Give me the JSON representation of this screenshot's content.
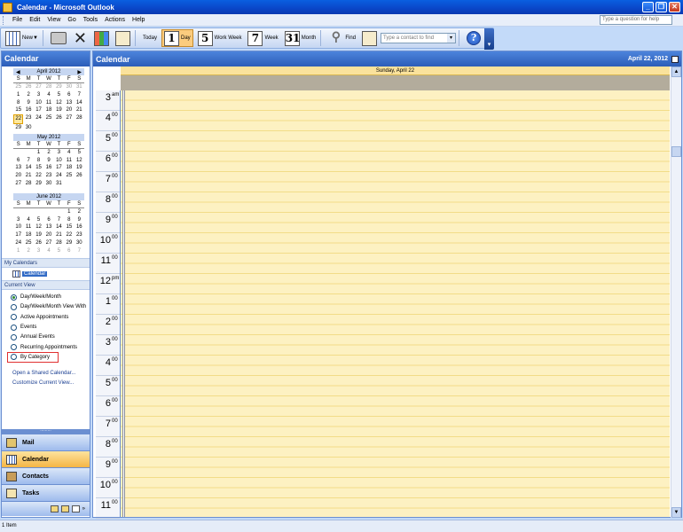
{
  "window": {
    "title": "Calendar - Microsoft Outlook",
    "buttons": [
      "_",
      "❐",
      "✕"
    ]
  },
  "menu": {
    "items": [
      "File",
      "Edit",
      "View",
      "Go",
      "Tools",
      "Actions",
      "Help"
    ],
    "help_placeholder": "Type a question for help"
  },
  "toolbar": {
    "new_label": "New",
    "today_label": "Today",
    "day_num": "1",
    "day_label": "Day",
    "workweek_num": "5",
    "workweek_label": "Work Week",
    "week_num": "7",
    "week_label": "Week",
    "month_num": "31",
    "month_label": "Month",
    "find_label": "Find",
    "contact_placeholder": "Type a contact to find",
    "help_glyph": "?"
  },
  "nav": {
    "title": "Calendar",
    "months": [
      {
        "title": "April 2012",
        "days": [
          "S",
          "M",
          "T",
          "W",
          "T",
          "F",
          "S"
        ],
        "dates": [
          "25",
          "26",
          "27",
          "28",
          "29",
          "30",
          "31",
          "1",
          "2",
          "3",
          "4",
          "5",
          "6",
          "7",
          "8",
          "9",
          "10",
          "11",
          "12",
          "13",
          "14",
          "15",
          "16",
          "17",
          "18",
          "19",
          "20",
          "21",
          "22",
          "23",
          "24",
          "25",
          "26",
          "27",
          "28",
          "29",
          "30"
        ],
        "dim": [
          0,
          1,
          2,
          3,
          4,
          5,
          6
        ],
        "selected": 28
      },
      {
        "title": "May 2012",
        "days": [
          "S",
          "M",
          "T",
          "W",
          "T",
          "F",
          "S"
        ],
        "dates": [
          "",
          "",
          "1",
          "2",
          "3",
          "4",
          "5",
          "6",
          "7",
          "8",
          "9",
          "10",
          "11",
          "12",
          "13",
          "14",
          "15",
          "16",
          "17",
          "18",
          "19",
          "20",
          "21",
          "22",
          "23",
          "24",
          "25",
          "26",
          "27",
          "28",
          "29",
          "30",
          "31"
        ],
        "dim": [],
        "selected": -1
      },
      {
        "title": "June 2012",
        "days": [
          "S",
          "M",
          "T",
          "W",
          "T",
          "F",
          "S"
        ],
        "dates": [
          "",
          "",
          "",
          "",
          "",
          "1",
          "2",
          "3",
          "4",
          "5",
          "6",
          "7",
          "8",
          "9",
          "10",
          "11",
          "12",
          "13",
          "14",
          "15",
          "16",
          "17",
          "18",
          "19",
          "20",
          "21",
          "22",
          "23",
          "24",
          "25",
          "26",
          "27",
          "28",
          "29",
          "30",
          "1",
          "2",
          "3",
          "4",
          "5",
          "6",
          "7"
        ],
        "dim": [
          35,
          36,
          37,
          38,
          39,
          40,
          41
        ],
        "selected": -1
      }
    ],
    "my_calendars_label": "My Calendars",
    "calendar_item": "Calendar",
    "current_view_label": "Current View",
    "views": [
      "Day/Week/Month",
      "Day/Week/Month View With",
      "Active Appointments",
      "Events",
      "Annual Events",
      "Recurring Appointments",
      "By Category"
    ],
    "links": [
      "Open a Shared Calendar...",
      "Customize Current View..."
    ],
    "buttons": {
      "mail": "Mail",
      "calendar": "Calendar",
      "contacts": "Contacts",
      "tasks": "Tasks"
    }
  },
  "main": {
    "title": "Calendar",
    "date": "April 22, 2012",
    "day_header": "Sunday, April 22",
    "hours": [
      {
        "h": "3",
        "m": "am"
      },
      {
        "h": "4",
        "m": "00"
      },
      {
        "h": "5",
        "m": "00"
      },
      {
        "h": "6",
        "m": "00"
      },
      {
        "h": "7",
        "m": "00"
      },
      {
        "h": "8",
        "m": "00"
      },
      {
        "h": "9",
        "m": "00"
      },
      {
        "h": "10",
        "m": "00"
      },
      {
        "h": "11",
        "m": "00"
      },
      {
        "h": "12",
        "m": "pm"
      },
      {
        "h": "1",
        "m": "00"
      },
      {
        "h": "2",
        "m": "00"
      },
      {
        "h": "3",
        "m": "00"
      },
      {
        "h": "4",
        "m": "00"
      },
      {
        "h": "5",
        "m": "00"
      },
      {
        "h": "6",
        "m": "00"
      },
      {
        "h": "7",
        "m": "00"
      },
      {
        "h": "8",
        "m": "00"
      },
      {
        "h": "9",
        "m": "00"
      },
      {
        "h": "10",
        "m": "00"
      },
      {
        "h": "11",
        "m": "00"
      }
    ]
  },
  "status": {
    "text": "1 Item"
  }
}
